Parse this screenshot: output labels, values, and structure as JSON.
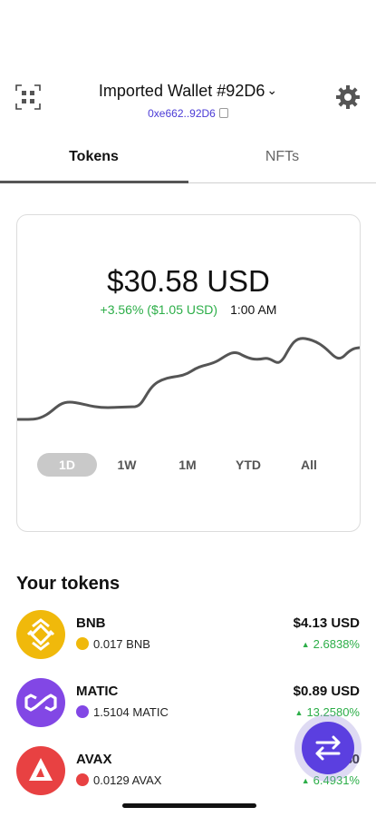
{
  "header": {
    "wallet_title": "Imported Wallet #92D6",
    "address": "0xe662..92D6"
  },
  "tabs": [
    {
      "label": "Tokens",
      "active": true
    },
    {
      "label": "NFTs",
      "active": false
    }
  ],
  "portfolio": {
    "balance": "$30.58 USD",
    "change": "+3.56% ($1.05 USD)",
    "time": "1:00 AM",
    "ranges": [
      {
        "label": "1D",
        "active": true
      },
      {
        "label": "1W",
        "active": false
      },
      {
        "label": "1M",
        "active": false
      },
      {
        "label": "YTD",
        "active": false
      },
      {
        "label": "All",
        "active": false
      }
    ]
  },
  "section_title": "Your tokens",
  "tokens": [
    {
      "name": "BNB",
      "amount": "0.017 BNB",
      "usd": "$4.13 USD",
      "change": "2.6838%",
      "color": "#f0b90b",
      "icon": "bnb-icon"
    },
    {
      "name": "MATIC",
      "amount": "1.5104 MATIC",
      "usd": "$0.89 USD",
      "change": "13.2580%",
      "color": "#8247e5",
      "icon": "matic-icon"
    },
    {
      "name": "AVAX",
      "amount": "0.0129 AVAX",
      "usd": "$0",
      "change": "6.4931%",
      "color": "#e84142",
      "icon": "avax-icon"
    }
  ],
  "colors": {
    "accent": "#5b3fe0",
    "positive": "#2cae48",
    "address": "#4b3bd6"
  }
}
